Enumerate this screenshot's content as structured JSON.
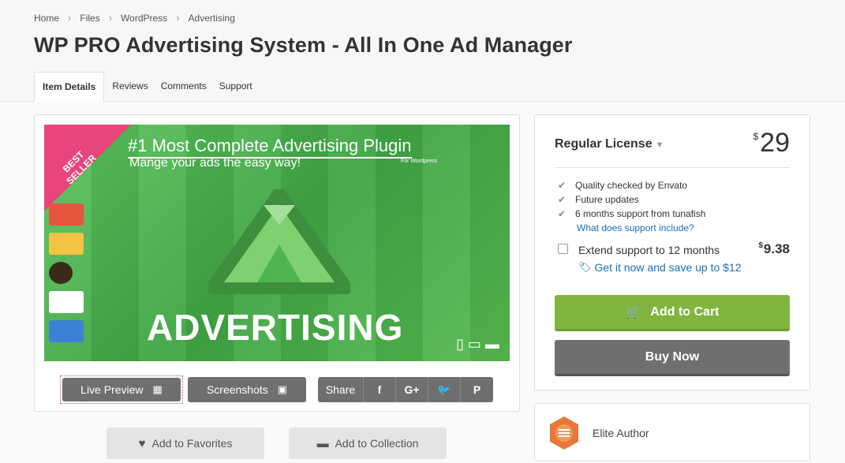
{
  "breadcrumb": [
    "Home",
    "Files",
    "WordPress",
    "Advertising"
  ],
  "page_title": "WP PRO Advertising System - All In One Ad Manager",
  "tabs": [
    {
      "label": "Item Details",
      "active": true
    },
    {
      "label": "Reviews"
    },
    {
      "label": "Comments"
    },
    {
      "label": "Support"
    }
  ],
  "banner": {
    "ribbon": "BEST SELLER",
    "title": "#1 Most Complete Advertising Plugin",
    "subtitle": "Mange your ads the easy way!",
    "small": "For Wordpress",
    "big": "ADVERTISING"
  },
  "preview_buttons": {
    "live_preview": "Live Preview",
    "screenshots": "Screenshots",
    "share": "Share"
  },
  "share_icons": [
    "facebook-icon",
    "google-plus-icon",
    "twitter-icon",
    "pinterest-icon"
  ],
  "bottom_buttons": {
    "favorites": "Add to Favorites",
    "collection": "Add to Collection"
  },
  "license": {
    "title": "Regular License",
    "currency": "$",
    "price": "29",
    "features": [
      "Quality checked by Envato",
      "Future updates",
      "6 months support from tunafish"
    ],
    "support_link": "What does support include?",
    "extend_label": "Extend support to 12 months",
    "extend_price": "9.38",
    "extend_save": "Get it now and save up to $12",
    "add_to_cart": "Add to Cart",
    "buy_now": "Buy Now"
  },
  "author": {
    "label": "Elite Author"
  },
  "colors": {
    "accent_green": "#82b440",
    "link_blue": "#1a6fb3",
    "button_grey": "#6f6f6f",
    "badge_orange": "#e8773a"
  }
}
